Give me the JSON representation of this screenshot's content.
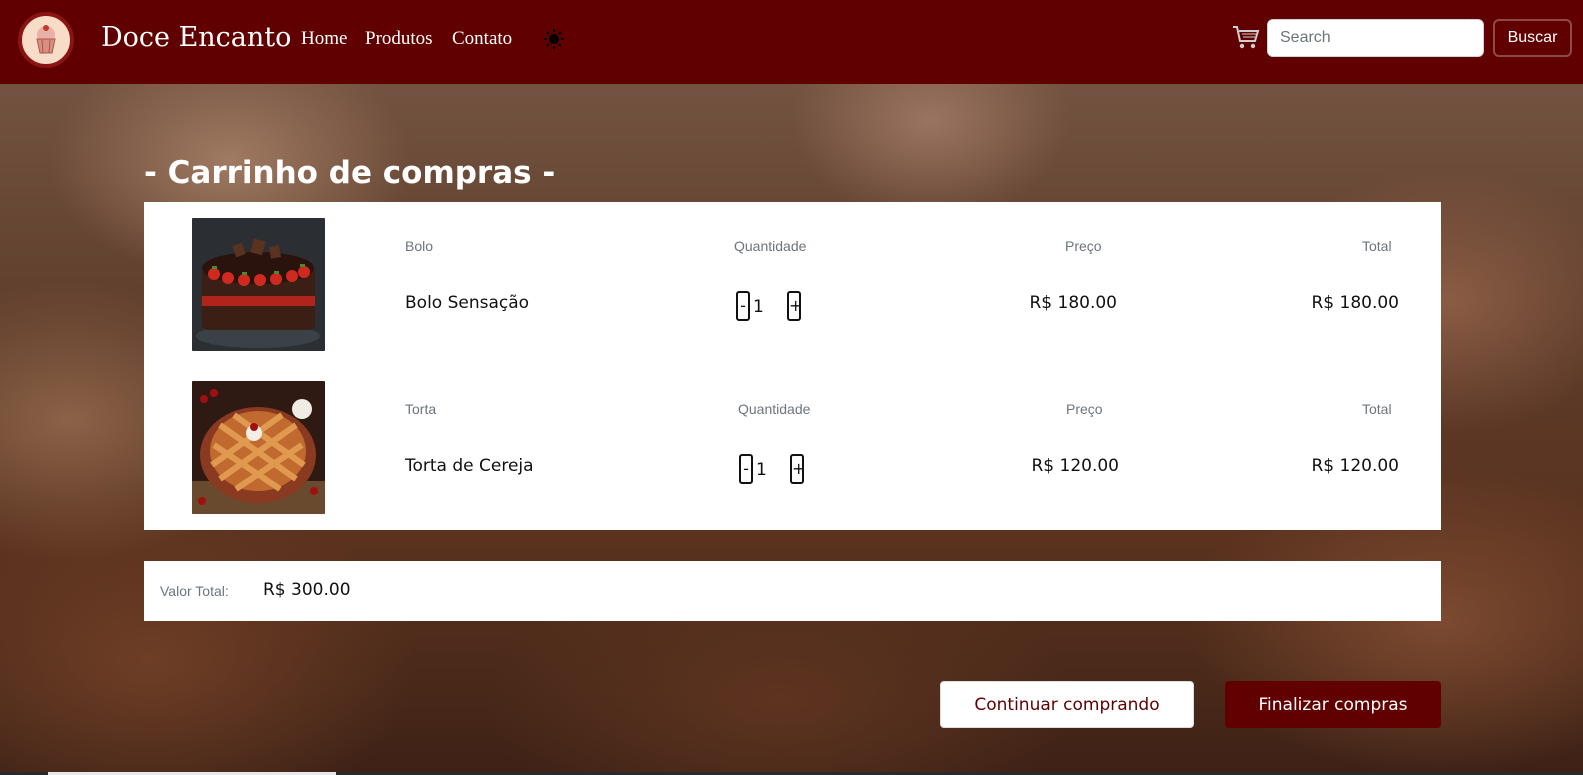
{
  "navbar": {
    "brand": "Doce Encanto",
    "links": [
      "Home",
      "Produtos",
      "Contato"
    ],
    "search_placeholder": "Search",
    "search_button": "Buscar",
    "colors": {
      "primary": "#600000"
    }
  },
  "page": {
    "title": "- Carrinho de compras -"
  },
  "cart": {
    "labels": {
      "quantity": "Quantidade",
      "price": "Preço",
      "total": "Total"
    },
    "items": [
      {
        "category": "Bolo",
        "name": "Bolo Sensação",
        "quantity": "1",
        "price": "R$ 180.00",
        "total": "R$ 180.00",
        "image": "chocolate-strawberry-cake"
      },
      {
        "category": "Torta",
        "name": "Torta de Cereja",
        "quantity": "1",
        "price": "R$ 120.00",
        "total": "R$ 120.00",
        "image": "cherry-pie"
      }
    ],
    "qty_minus": "-",
    "qty_plus": "+"
  },
  "summary": {
    "label": "Valor Total:",
    "value": "R$ 300.00"
  },
  "actions": {
    "continue": "Continuar comprando",
    "finish": "Finalizar compras"
  }
}
